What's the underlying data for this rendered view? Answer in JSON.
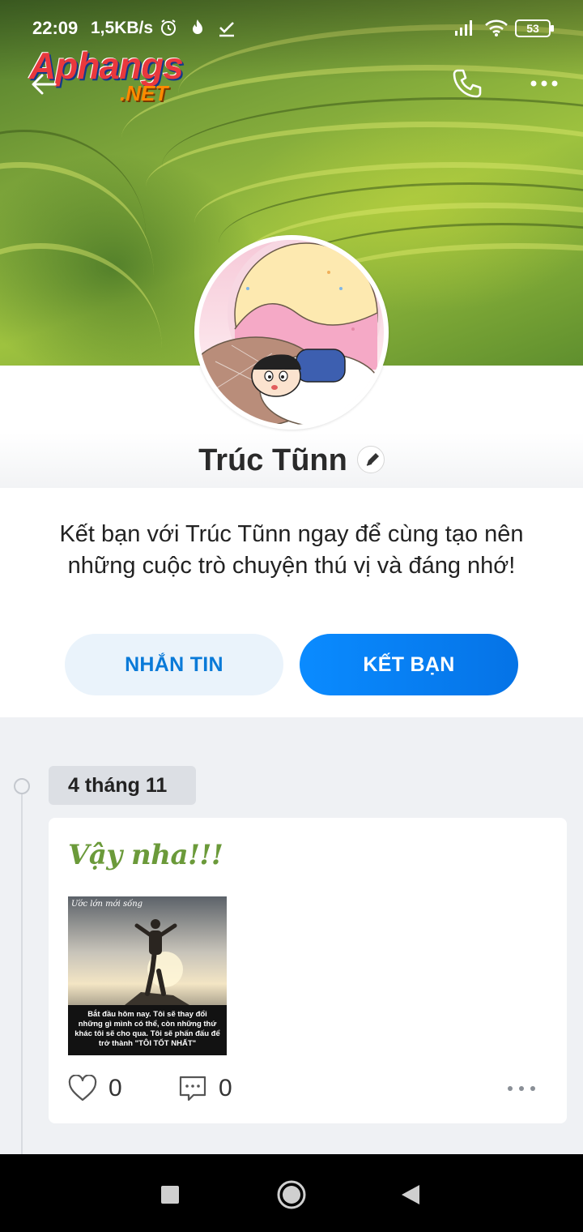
{
  "status_bar": {
    "time": "22:09",
    "speed": "1,5KB/s",
    "battery": "53",
    "icons": [
      "alarm-icon",
      "flame-icon",
      "check-download-icon",
      "signal-icon",
      "wifi-icon",
      "battery-icon"
    ]
  },
  "header": {
    "logo_main": "Aphangs",
    "logo_sub": ".NET",
    "icons": [
      "back-arrow-icon",
      "phone-icon",
      "more-dots-icon"
    ]
  },
  "profile": {
    "name": "Trúc Tũnn"
  },
  "invite": {
    "text": "Kết bạn với Trúc Tũnn ngay để cùng tạo nên những cuộc trò chuyện thú vị và đáng nhớ!",
    "message_button": "NHẮN TIN",
    "add_friend_button": "KẾT BẠN"
  },
  "timeline": {
    "date": "4 tháng 11",
    "post": {
      "title": "Vậy nha!!!",
      "image_watermark": "Ước lớn mới sống",
      "image_caption": "Bắt đầu hôm nay. Tôi sẽ thay đổi những gì mình có thể, còn những thứ khác tôi sẽ cho qua. Tôi sẽ phấn đấu để trở thành \"TÔI TỐT NHẤT\"",
      "likes": "0",
      "comments": "0"
    }
  },
  "colors": {
    "accent": "#0a7ad8",
    "primary_button": "#0a8bff",
    "secondary_button_bg": "#eaf3fb",
    "post_title": "#6b9a3a",
    "page_bg": "#eff1f4"
  }
}
